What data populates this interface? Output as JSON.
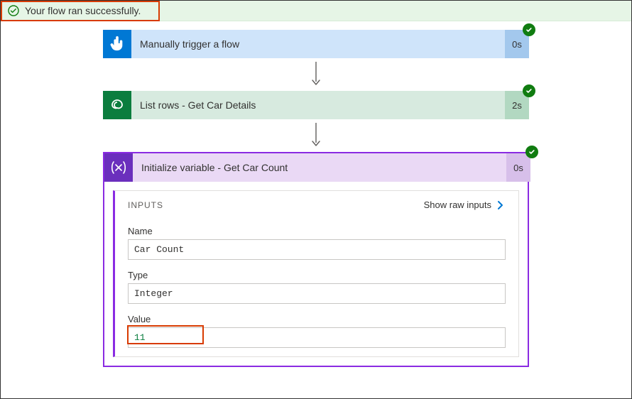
{
  "banner": {
    "message": "Your flow ran successfully."
  },
  "cards": {
    "trigger": {
      "title": "Manually trigger a flow",
      "duration": "0s"
    },
    "listrows": {
      "title": "List rows - Get Car Details",
      "duration": "2s"
    },
    "initvar": {
      "title": "Initialize variable - Get Car Count",
      "duration": "0s"
    }
  },
  "inputs": {
    "heading": "INPUTS",
    "show_raw": "Show raw inputs",
    "name_label": "Name",
    "name_value": "Car Count",
    "type_label": "Type",
    "type_value": "Integer",
    "value_label": "Value",
    "value_value": "11"
  }
}
